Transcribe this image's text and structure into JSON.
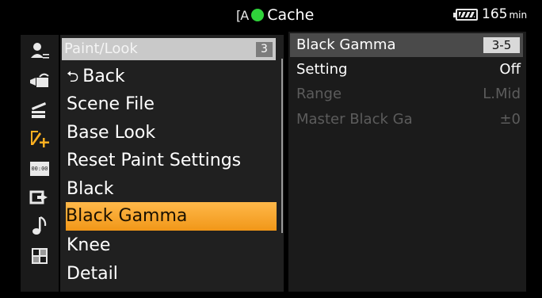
{
  "status": {
    "center_icon": "camera-a-icon",
    "center_icon_glyph": "[A",
    "rec_color": "#2fd33a",
    "center_label": "Cache",
    "battery_value": "165",
    "battery_unit": "min"
  },
  "left_tabs": [
    {
      "name": "user-menu-icon"
    },
    {
      "name": "recording-icon"
    },
    {
      "name": "clapper-icon"
    },
    {
      "name": "paint-icon",
      "active": true,
      "accent": "#ffb021"
    },
    {
      "name": "timecode-icon"
    },
    {
      "name": "output-icon"
    },
    {
      "name": "audio-icon"
    },
    {
      "name": "system-icon"
    }
  ],
  "menu": {
    "header_label": "Paint/Look",
    "header_page": "3",
    "items": [
      {
        "label": "Back",
        "icon": "back-arrow-icon",
        "glyph": "⮌"
      },
      {
        "label": "Scene File"
      },
      {
        "label": "Base Look"
      },
      {
        "label": "Reset Paint Settings"
      },
      {
        "label": "Black"
      },
      {
        "label": "Black Gamma",
        "selected": true
      },
      {
        "label": "Knee"
      },
      {
        "label": "Detail"
      }
    ],
    "selected_color": "#f4a12b"
  },
  "detail": {
    "title": "Black Gamma",
    "page": "3-5",
    "rows": [
      {
        "label": "Setting",
        "value": "Off",
        "enabled": true
      },
      {
        "label": "Range",
        "value": "L.Mid",
        "enabled": false
      },
      {
        "label": "Master Black Ga",
        "value": "±0",
        "enabled": false
      }
    ]
  }
}
